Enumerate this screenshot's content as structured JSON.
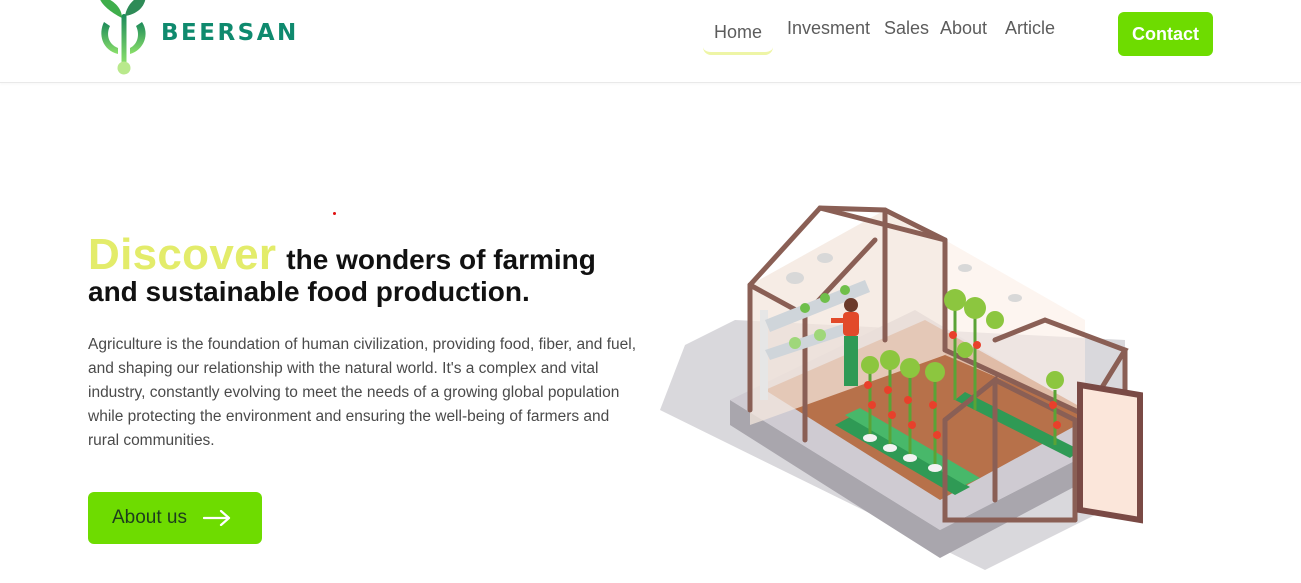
{
  "brand": {
    "name": "BEERSAN",
    "logo_icon": "sprout-logo-icon",
    "color": "#0f8a6e"
  },
  "nav": {
    "items": [
      {
        "label": "Home",
        "active": true
      },
      {
        "label": "Invesment",
        "active": false
      },
      {
        "label": "Sales",
        "active": false
      },
      {
        "label": "About",
        "active": false
      },
      {
        "label": "Article",
        "active": false
      }
    ],
    "contact_label": "Contact"
  },
  "hero": {
    "highlight": "Discover",
    "title_rest_line1": "the wonders of farming",
    "title_line2": "and sustainable food production.",
    "description": "Agriculture is the foundation of human civilization, providing food, fiber, and fuel, and shaping our relationship with the natural world. It's a complex and vital industry, constantly evolving to meet the needs of a growing global population while protecting the environment and ensuring the well-being of farmers and rural communities.",
    "cta_label": "About us",
    "cta_icon": "arrow-right-icon",
    "illustration": "greenhouse-illustration"
  },
  "colors": {
    "accent": "#6edc00",
    "highlight": "#e3ec6a",
    "text": "#111111"
  }
}
